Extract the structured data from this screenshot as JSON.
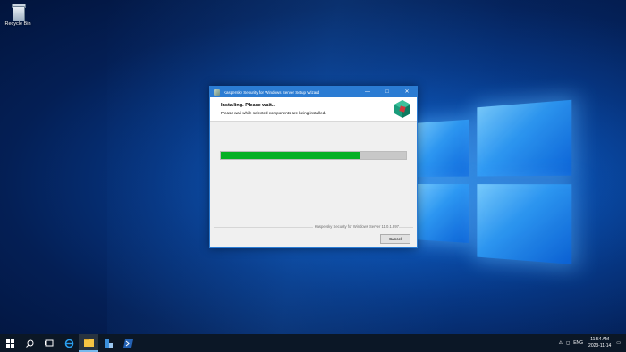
{
  "desktop": {
    "icons": [
      {
        "label": "Recycle Bin",
        "icon": "recycle-bin-icon"
      }
    ]
  },
  "dialog": {
    "title": "Kaspersky Security for Windows Server Setup Wizard",
    "controls": {
      "minimize": "—",
      "maximize": "□",
      "close": "✕"
    },
    "header_title": "Installing. Please wait...",
    "header_subtitle": "Please wait while selected components are being installed.",
    "progress_fraction": 0.75,
    "version_text": "Kaspersky Security for Windows Server 11.0.1.897",
    "cancel_label": "Cancel",
    "colors": {
      "titlebar": "#2b7cd3",
      "progress": "#06b025"
    }
  },
  "taskbar": {
    "items": [
      {
        "name": "start",
        "icon": "windows-start-icon"
      },
      {
        "name": "search",
        "icon": "search-icon"
      },
      {
        "name": "task-view",
        "icon": "task-view-icon"
      },
      {
        "name": "edge",
        "icon": "internet-explorer-icon"
      },
      {
        "name": "explorer",
        "icon": "folder-icon"
      },
      {
        "name": "server-manager",
        "icon": "server-manager-icon"
      },
      {
        "name": "powershell",
        "icon": "powershell-icon"
      }
    ],
    "tray": {
      "language": "ENG",
      "time": "11:54 AM",
      "date": "2023-11-14"
    }
  }
}
